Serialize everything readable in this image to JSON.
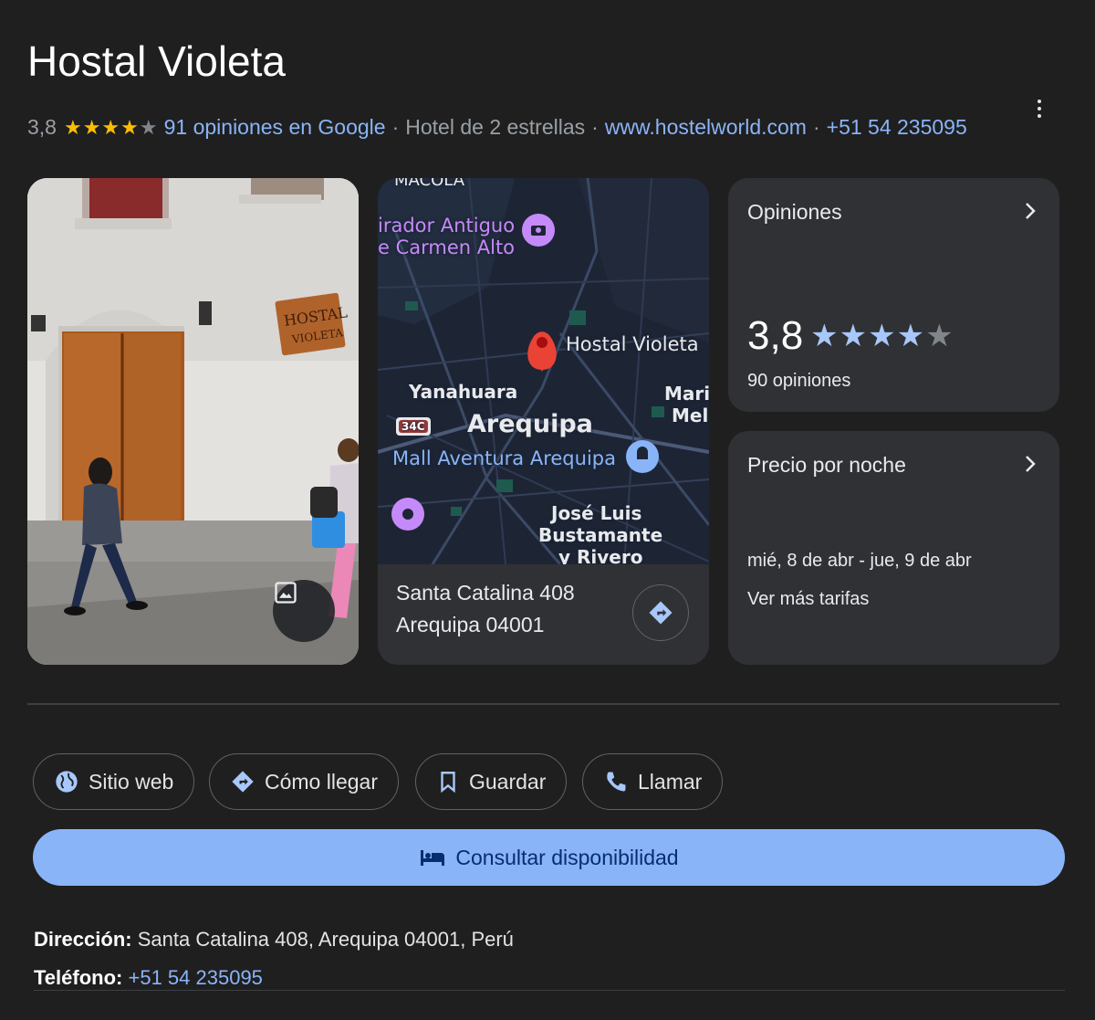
{
  "header": {
    "title": "Hostal Violeta",
    "rating": "3,8",
    "stars_full": "★★★★",
    "stars_empty": "★",
    "reviews_link": "91 opiniones en Google",
    "separator": "·",
    "hotel_class": "Hotel de 2 estrellas",
    "website": "www.hostelworld.com",
    "phone": "+51 54 235095"
  },
  "photo": {
    "sign_line1": "HOSTAL",
    "sign_line2": "VIOLETA",
    "photos_icon": "image-icon"
  },
  "map": {
    "labels": {
      "top_cut": "MACOLA",
      "mirador_1": "irador Antiguo",
      "mirador_2": "e Carmen Alto",
      "marker": "Hostal Violeta",
      "yanahuara": "Yanahuara",
      "road": "34C",
      "city": "Arequipa",
      "mari": "Mari",
      "mel": "Mel",
      "mall": "Mall Aventura Arequipa",
      "jose_1": "José Luis",
      "jose_2": "Bustamante",
      "jose_3": "y Rivero"
    },
    "address_line1": "Santa Catalina 408",
    "address_line2": "Arequipa 04001",
    "directions_icon": "directions-icon"
  },
  "reviews_card": {
    "title": "Opiniones",
    "rating": "3,8",
    "stars_full": "★★★★",
    "stars_empty": "★",
    "count": "90 opiniones"
  },
  "price_card": {
    "title": "Precio por noche",
    "dates": "mié, 8 de abr - jue, 9 de abr",
    "more_rates": "Ver más tarifas"
  },
  "actions": {
    "website": "Sitio web",
    "directions": "Cómo llegar",
    "save": "Guardar",
    "call": "Llamar",
    "availability": "Consultar disponibilidad"
  },
  "details": {
    "address_label": "Dirección:",
    "address_value": "Santa Catalina 408, Arequipa 04001, Perú",
    "phone_label": "Teléfono:",
    "phone_value": "+51 54 235095"
  },
  "colors": {
    "background": "#1f1f1f",
    "card": "#303134",
    "link": "#8ab4f8",
    "star_gold": "#fbbc04",
    "star_blue": "#a8c7fa",
    "primary_button": "#8ab4f8",
    "map_pin": "#ea4335",
    "map_poi": "#c58af9"
  }
}
